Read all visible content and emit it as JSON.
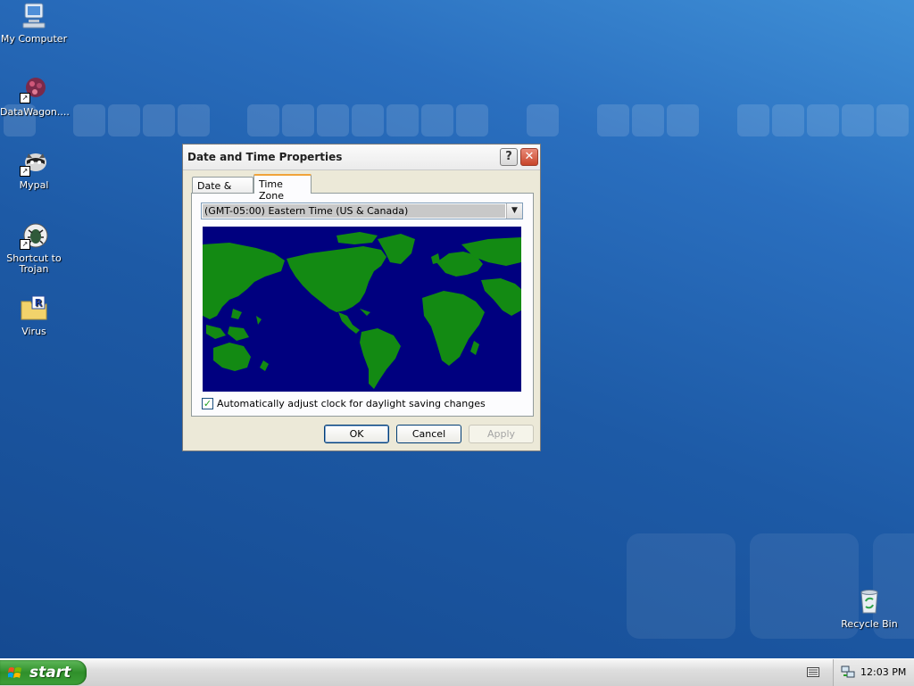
{
  "desktop": {
    "icons": [
      {
        "label": "My Computer",
        "icon": "my-computer-icon"
      },
      {
        "label": "DataWagon....",
        "icon": "datawagon-shortcut-icon"
      },
      {
        "label": "Mypal",
        "icon": "mypal-shortcut-icon"
      },
      {
        "label": "Shortcut to Trojan",
        "icon": "trojan-shortcut-icon"
      },
      {
        "label": "Virus",
        "icon": "virus-folder-icon"
      },
      {
        "label": "Recycle Bin",
        "icon": "recycle-bin-icon"
      }
    ]
  },
  "dialog": {
    "title": "Date and Time Properties",
    "help_glyph": "?",
    "close_glyph": "✕",
    "tabs": [
      {
        "label": "Date & Time",
        "active": false
      },
      {
        "label": "Time Zone",
        "active": true
      }
    ],
    "timezone": {
      "selected": "(GMT-05:00) Eastern Time (US & Canada)"
    },
    "dst_checkbox": {
      "label": "Automatically adjust clock for daylight saving changes",
      "checked": true,
      "mark": "✓"
    },
    "buttons": {
      "ok": "OK",
      "cancel": "Cancel",
      "apply": "Apply"
    },
    "map_colors": {
      "ocean": "#00007f",
      "land": "#138a13"
    }
  },
  "taskbar": {
    "start_label": "start",
    "clock": "12:03 PM"
  }
}
